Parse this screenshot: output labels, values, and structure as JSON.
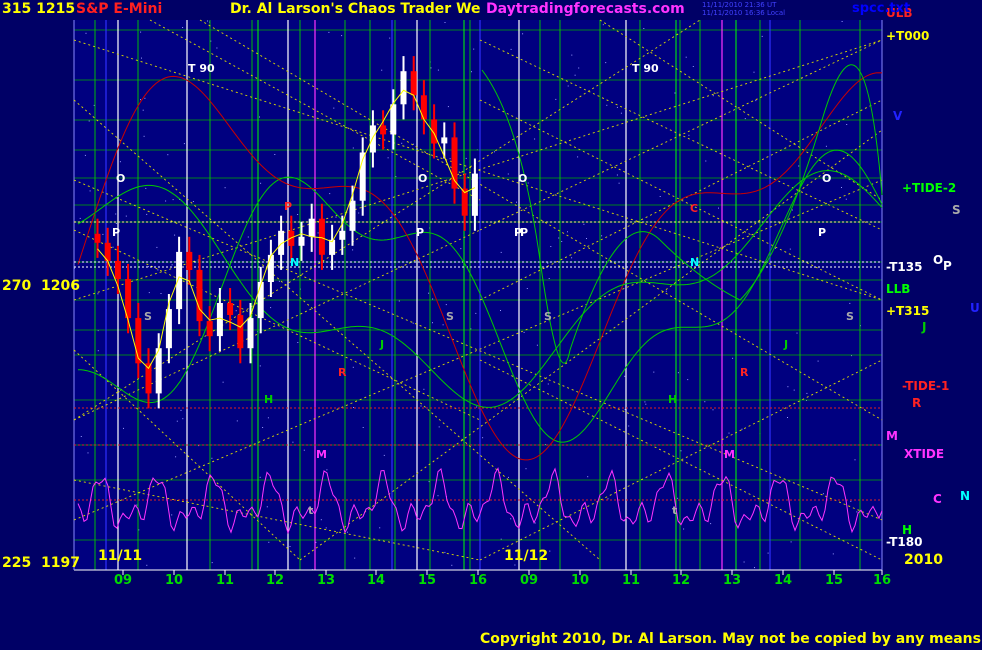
{
  "header": {
    "left_numbers": "315  1215",
    "instrument": "S&P E-Mini",
    "title": "Dr. Al Larson's Chaos Trader We",
    "site": "Daytradingforecasts.com",
    "timestamp1": "11/11/2010 21:36 UT",
    "timestamp2": "11/11/2010 16:36 Local",
    "file": "spcc.txt"
  },
  "footer": {
    "copyright": "Copyright 2010, Dr. Al Larson. May not be copied by any means."
  },
  "colors": {
    "background": "#000066",
    "plot_background": "#000080",
    "green_grid": "#00cc00",
    "yellow_diag": "#cccc00",
    "price_up": "#ffffff",
    "price_down": "#ff0000",
    "label_yellow": "#ffff00"
  },
  "chart_data": {
    "type": "line",
    "title": "S&P E-Mini",
    "y_left_labels": [
      {
        "angle": "315",
        "price": "1215",
        "value": 1215
      },
      {
        "angle": "270",
        "price": "1206",
        "value": 1206
      },
      {
        "angle": "225",
        "price": "1197",
        "value": 1197
      }
    ],
    "ylim": [
      1197,
      1215
    ],
    "dates": [
      "11/11",
      "11/12"
    ],
    "year": "2010",
    "x_ticks": [
      "09",
      "10",
      "11",
      "12",
      "13",
      "14",
      "15",
      "16",
      "09",
      "10",
      "11",
      "12",
      "13",
      "14",
      "15",
      "16"
    ],
    "right_labels": [
      "ULB",
      "+T000",
      "V",
      "+TIDE-2",
      "S",
      "-T135",
      "O",
      "P",
      "LLB",
      "+T315",
      "U",
      "J",
      "-TIDE-1",
      "R",
      "M",
      "XTIDE",
      "C",
      "N",
      "H",
      "-T180"
    ],
    "markers": [
      "T 90",
      "T 90",
      "O",
      "O",
      "O",
      "O",
      "P",
      "P",
      "P",
      "P",
      "P",
      "S",
      "S",
      "S",
      "S",
      "H",
      "H",
      "J",
      "J",
      "M",
      "M",
      "R",
      "R",
      "C",
      "N",
      "N",
      "t",
      "t",
      "P"
    ],
    "price_series": {
      "name": "S&P E-Mini",
      "x_hours": [
        8.5,
        8.7,
        8.9,
        9.1,
        9.3,
        9.5,
        9.7,
        9.9,
        10.1,
        10.3,
        10.5,
        10.7,
        10.9,
        11.1,
        11.3,
        11.5,
        11.7,
        11.9,
        12.1,
        12.3,
        12.5,
        12.7,
        12.9,
        13.1,
        13.3,
        13.5,
        13.7,
        13.9,
        14.1,
        14.3,
        14.5,
        14.7,
        14.9,
        15.1,
        15.3,
        15.5,
        15.7,
        15.9
      ],
      "close": [
        1207.6,
        1207.0,
        1206.4,
        1205.1,
        1203.6,
        1202.6,
        1204.1,
        1205.4,
        1207.3,
        1206.7,
        1205.0,
        1204.5,
        1205.6,
        1205.2,
        1204.1,
        1205.1,
        1206.3,
        1207.2,
        1208.0,
        1207.5,
        1207.8,
        1208.4,
        1207.2,
        1207.7,
        1208.0,
        1209.0,
        1210.6,
        1211.5,
        1211.2,
        1212.2,
        1213.3,
        1212.5,
        1211.7,
        1210.9,
        1211.1,
        1209.4,
        1208.5,
        1209.9
      ],
      "color_sign": [
        -1,
        -1,
        -1,
        -1,
        -1,
        -1,
        1,
        1,
        1,
        -1,
        -1,
        -1,
        1,
        -1,
        -1,
        1,
        1,
        1,
        1,
        -1,
        1,
        1,
        -1,
        1,
        1,
        1,
        1,
        1,
        -1,
        1,
        1,
        -1,
        -1,
        -1,
        1,
        -1,
        -1,
        1
      ]
    }
  }
}
